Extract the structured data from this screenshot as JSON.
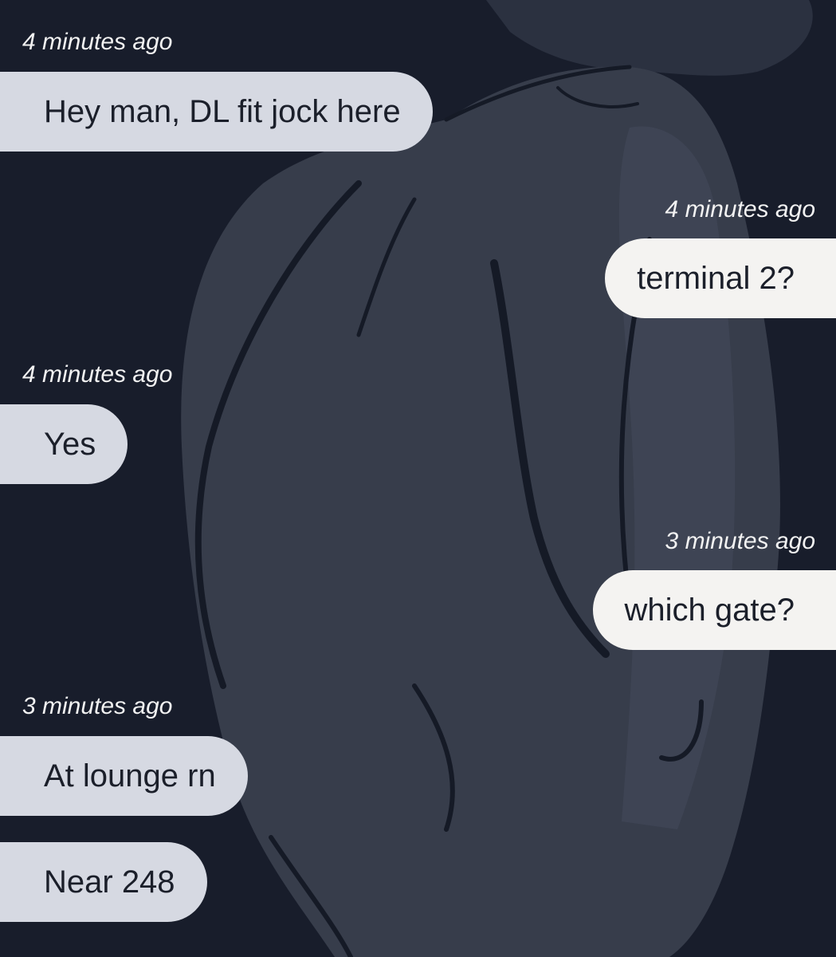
{
  "chat": {
    "background": {
      "base_color": "#181d2b",
      "figure_color": "#373d4b",
      "line_color": "#151a26"
    },
    "bubble_colors": {
      "received": "#d6d9e2",
      "sent": "#f4f3f1"
    },
    "messages": [
      {
        "direction": "received",
        "time": "4 minutes ago",
        "text": "Hey man, DL fit jock here"
      },
      {
        "direction": "sent",
        "time": "4 minutes ago",
        "text": "terminal 2?"
      },
      {
        "direction": "received",
        "time": "4 minutes ago",
        "text": "Yes"
      },
      {
        "direction": "sent",
        "time": "3 minutes ago",
        "text": "which gate?"
      },
      {
        "direction": "received",
        "time": "3 minutes ago",
        "text": "At lounge rn"
      },
      {
        "direction": "received",
        "time": "",
        "text": "Near 248"
      }
    ]
  }
}
